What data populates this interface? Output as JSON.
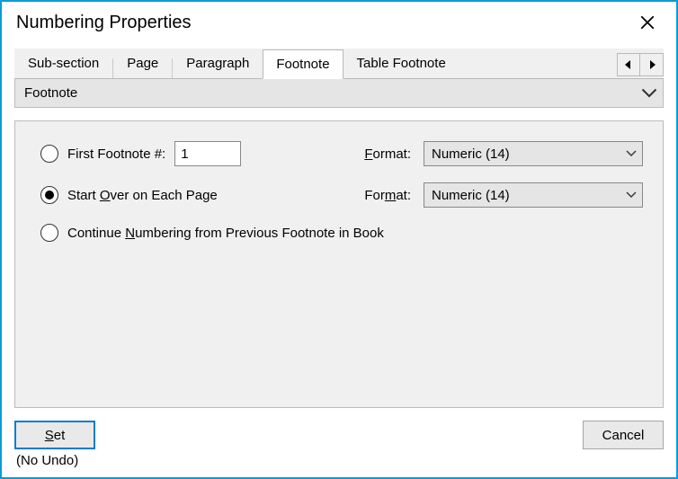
{
  "window": {
    "title": "Numbering Properties"
  },
  "tabs": {
    "items": [
      {
        "label": "Sub-section",
        "active": false
      },
      {
        "label": "Page",
        "active": false
      },
      {
        "label": "Paragraph",
        "active": false
      },
      {
        "label": "Footnote",
        "active": true
      },
      {
        "label": "Table Footnote",
        "active": false
      }
    ]
  },
  "section_dropdown": {
    "value": "Footnote"
  },
  "options": {
    "first_footnote": {
      "label_pre": "First Footnote #:",
      "value": "1",
      "selected": false
    },
    "start_over": {
      "label_pre": "Start ",
      "label_u": "O",
      "label_post": "ver on Each Page",
      "selected": true
    },
    "continue": {
      "label_pre": "Continue ",
      "label_u": "N",
      "label_post": "umbering from Previous Footnote in Book",
      "selected": false
    }
  },
  "formats": {
    "row1": {
      "label_u": "F",
      "label_post": "ormat:",
      "value": "Numeric  (14)"
    },
    "row2": {
      "label_pre": "For",
      "label_u": "m",
      "label_post": "at:",
      "value": "Numeric  (14)"
    }
  },
  "buttons": {
    "set_u": "S",
    "set_post": "et",
    "cancel": "Cancel"
  },
  "undo_note": "(No Undo)"
}
